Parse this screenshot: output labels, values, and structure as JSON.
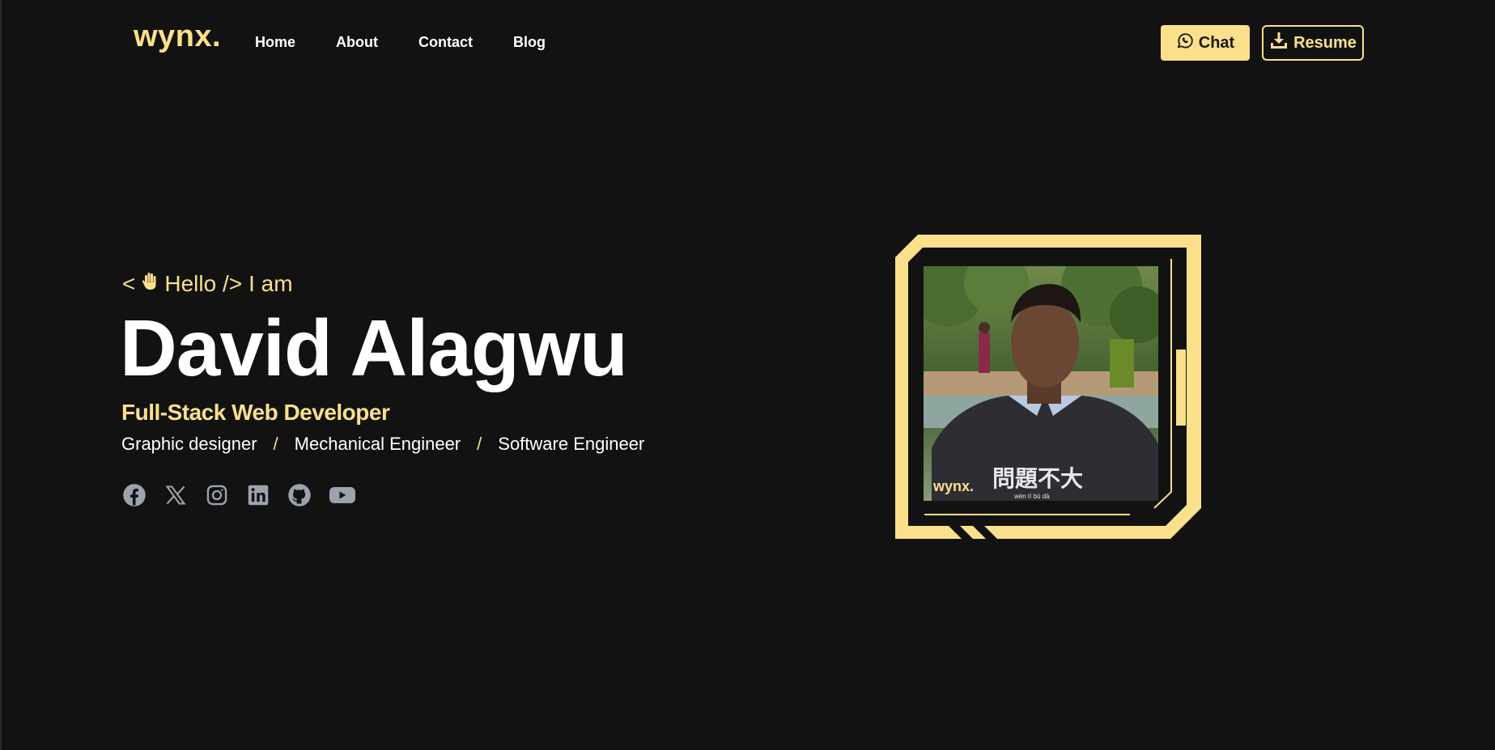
{
  "header": {
    "logo": "wynx.",
    "nav": [
      {
        "label": "Home"
      },
      {
        "label": "About"
      },
      {
        "label": "Contact"
      },
      {
        "label": "Blog"
      }
    ],
    "chat_label": "Chat",
    "resume_label": "Resume"
  },
  "hero": {
    "greeting_open": "<",
    "greeting_icon": "waving-hand-icon",
    "greeting_text": "Hello />",
    "greeting_suffix": "I am",
    "name": "David Alagwu",
    "primary_role": "Full-Stack Web Developer",
    "roles": [
      "Graphic designer",
      "Mechanical Engineer",
      "Software Engineer"
    ],
    "role_separator": "/",
    "socials": [
      {
        "icon": "facebook-icon"
      },
      {
        "icon": "x-icon"
      },
      {
        "icon": "instagram-icon"
      },
      {
        "icon": "linkedin-icon"
      },
      {
        "icon": "github-icon"
      },
      {
        "icon": "youtube-icon"
      }
    ]
  },
  "photo": {
    "watermark": "wynx.",
    "shirt_text": "問題不大",
    "shirt_subtext": "wèn tí bù dà"
  },
  "colors": {
    "background": "#121212",
    "accent": "#FBE08B",
    "text": "#ffffff",
    "icon": "#9ca3af"
  }
}
